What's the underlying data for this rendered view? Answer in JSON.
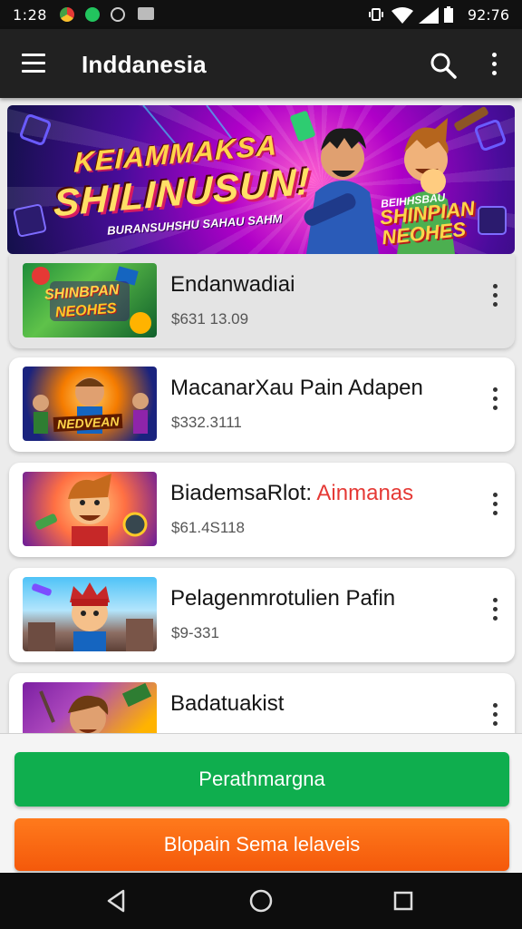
{
  "status_bar": {
    "time_left": "1:28",
    "time_right": "92:76"
  },
  "app_bar": {
    "title": "Inddanesia",
    "menu_icon": "menu-icon",
    "search_icon": "search-icon",
    "more_icon": "more-vertical-icon"
  },
  "banner": {
    "headline_top": "KEIAMMAKSA",
    "headline_main": "SHILINUSUN!",
    "subline": "BURANSUHSHU SAHAU SAHM",
    "brand_small": "BEIHHSBAU",
    "brand_large_1": "SHINPIAN",
    "brand_large_2": "NEOHES"
  },
  "items": [
    {
      "title": "Endanwadiai",
      "title_accent": "",
      "price": "$631 13.09",
      "thumb_text_1": "SHINBPAN",
      "thumb_text_2": "NEOHES",
      "selected": true
    },
    {
      "title": "MacanarXau Pain Adapen",
      "title_accent": "",
      "price": "$332.3111",
      "thumb_text_1": "NEDVEAN",
      "thumb_text_2": "",
      "selected": false
    },
    {
      "title": "BiademsaRlot: ",
      "title_accent": "Ainmanas",
      "price": "$61.4S118",
      "thumb_text_1": "",
      "thumb_text_2": "",
      "selected": false
    },
    {
      "title": "Pelagenmrotulien Pafin",
      "title_accent": "",
      "price": "$9-331",
      "thumb_text_1": "",
      "thumb_text_2": "",
      "selected": false
    },
    {
      "title": "Badatuakist",
      "title_accent": "",
      "price": "",
      "thumb_text_1": "",
      "thumb_text_2": "",
      "selected": false
    }
  ],
  "buttons": {
    "primary": "Perathmargna",
    "secondary": "Blopain Sema lelaveis"
  },
  "colors": {
    "primary_button": "#0fae4e",
    "secondary_button": "#f4590b",
    "app_bar": "#212121",
    "accent_red": "#e53935"
  },
  "nav": {
    "back_icon": "back-triangle-icon",
    "home_icon": "home-circle-icon",
    "recents_icon": "recents-square-icon"
  }
}
